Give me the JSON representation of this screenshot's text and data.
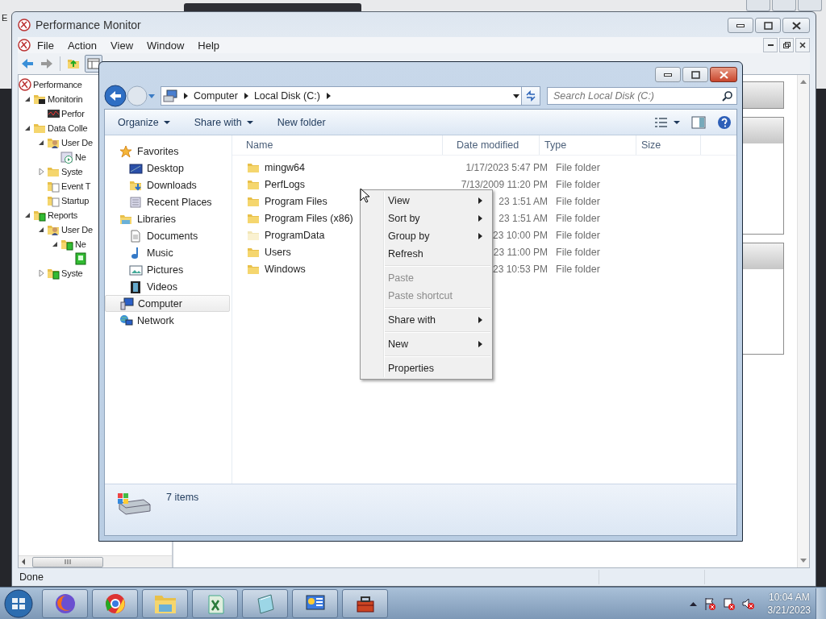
{
  "background_window": {
    "text": "E"
  },
  "perfmon": {
    "title": "Performance Monitor",
    "menu": [
      "File",
      "Action",
      "View",
      "Window",
      "Help"
    ],
    "tree": [
      {
        "label": "Performance",
        "kind": "gauge",
        "children": [
          {
            "label": "Monitorin",
            "kind": "monitor",
            "expanded": true,
            "children": [
              {
                "label": "Perfor",
                "kind": "chart"
              }
            ]
          },
          {
            "label": "Data Colle",
            "kind": "folder",
            "expanded": true,
            "children": [
              {
                "label": "User De",
                "kind": "user",
                "expanded": true,
                "children": [
                  {
                    "label": "Ne",
                    "kind": "task"
                  }
                ]
              },
              {
                "label": "Syste",
                "kind": "folder",
                "expanded": false
              },
              {
                "label": "Event T",
                "kind": "doc"
              },
              {
                "label": "Startup",
                "kind": "doc"
              }
            ]
          },
          {
            "label": "Reports",
            "kind": "report",
            "expanded": true,
            "children": [
              {
                "label": "User De",
                "kind": "user",
                "expanded": true,
                "children": [
                  {
                    "label": "Ne",
                    "kind": "report",
                    "expanded": true,
                    "children": [
                      {
                        "kind": "book"
                      }
                    ]
                  }
                ]
              },
              {
                "label": "Syste",
                "kind": "report",
                "expanded": false
              }
            ]
          }
        ]
      }
    ],
    "status_bar": "Done"
  },
  "explorer": {
    "address": [
      "Computer",
      "Local Disk (C:)"
    ],
    "search": {
      "placeholder": "Search Local Disk (C:)"
    },
    "toolbar": [
      {
        "label": "Organize",
        "dropdown": true
      },
      {
        "label": "Share with",
        "dropdown": true
      },
      {
        "label": "New folder",
        "dropdown": false
      }
    ],
    "nav": [
      {
        "label": "Favorites",
        "kind": "star",
        "selected": false,
        "children": [
          {
            "label": "Desktop",
            "kind": "desktop",
            "selected": false
          },
          {
            "label": "Downloads",
            "kind": "download",
            "selected": false
          },
          {
            "label": "Recent Places",
            "kind": "recent",
            "selected": false
          }
        ]
      },
      {
        "label": "Libraries",
        "kind": "library",
        "selected": false,
        "children": [
          {
            "label": "Documents",
            "kind": "doc",
            "selected": false
          },
          {
            "label": "Music",
            "kind": "music",
            "selected": false
          },
          {
            "label": "Pictures",
            "kind": "pictures",
            "selected": false
          },
          {
            "label": "Videos",
            "kind": "video",
            "selected": false
          }
        ]
      },
      {
        "label": "Computer",
        "kind": "computer",
        "selected": true
      },
      {
        "label": "Network",
        "kind": "network",
        "selected": false
      }
    ],
    "columns": [
      "Name",
      "Date modified",
      "Type",
      "Size"
    ],
    "rows": [
      {
        "name": "mingw64",
        "date": "1/17/2023 5:47 PM",
        "type": "File folder",
        "hidden": false
      },
      {
        "name": "PerfLogs",
        "date": "7/13/2009 11:20 PM",
        "type": "File folder",
        "hidden": false
      },
      {
        "name": "Program Files",
        "date": "23 1:51 AM",
        "type": "File folder",
        "hidden": false
      },
      {
        "name": "Program Files (x86)",
        "date": "23 1:51 AM",
        "type": "File folder",
        "hidden": false
      },
      {
        "name": "ProgramData",
        "date": "23 10:00 PM",
        "type": "File folder",
        "hidden": true
      },
      {
        "name": "Users",
        "date": "23 11:00 PM",
        "type": "File folder",
        "hidden": false
      },
      {
        "name": "Windows",
        "date": "23 10:53 PM",
        "type": "File folder",
        "hidden": false
      }
    ],
    "item_count": "7 items"
  },
  "context_menu": [
    {
      "kind": "item",
      "label": "View",
      "submenu": true,
      "disabled": false
    },
    {
      "kind": "item",
      "label": "Sort by",
      "submenu": true,
      "disabled": false
    },
    {
      "kind": "item",
      "label": "Group by",
      "submenu": true,
      "disabled": false
    },
    {
      "kind": "item",
      "label": "Refresh",
      "submenu": false,
      "disabled": false
    },
    {
      "kind": "separator"
    },
    {
      "kind": "item",
      "label": "Paste",
      "submenu": false,
      "disabled": true
    },
    {
      "kind": "item",
      "label": "Paste shortcut",
      "submenu": false,
      "disabled": true
    },
    {
      "kind": "separator"
    },
    {
      "kind": "item",
      "label": "Share with",
      "submenu": true,
      "disabled": false
    },
    {
      "kind": "separator"
    },
    {
      "kind": "item",
      "label": "New",
      "submenu": true,
      "disabled": false
    },
    {
      "kind": "separator"
    },
    {
      "kind": "item",
      "label": "Properties",
      "submenu": false,
      "disabled": false
    }
  ],
  "taskbar": {
    "apps": [
      {
        "kind": "fox"
      },
      {
        "kind": "wheel"
      },
      {
        "kind": "folders"
      },
      {
        "kind": "spreadsheet"
      },
      {
        "kind": "notes"
      },
      {
        "kind": "panel"
      },
      {
        "kind": "toolbox"
      }
    ],
    "time": "10:04 AM",
    "date": "3/21/2023"
  }
}
